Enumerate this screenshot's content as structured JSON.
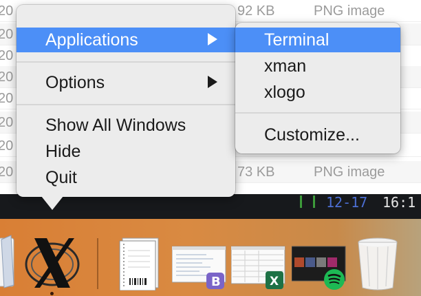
{
  "finder_rows": [
    {
      "date": "20",
      "size": "92 KB",
      "kind": "PNG image"
    },
    {
      "date": "20",
      "size": "",
      "kind": ""
    },
    {
      "date": "20",
      "size": "",
      "kind": ""
    },
    {
      "date": "20",
      "size": "",
      "kind": ""
    },
    {
      "date": "20",
      "size": "",
      "kind": ""
    },
    {
      "date": "20",
      "size": "",
      "kind": ""
    },
    {
      "date": "20",
      "size": "",
      "kind": ""
    },
    {
      "date": "20",
      "size": "73 KB",
      "kind": "PNG image"
    }
  ],
  "terminal": {
    "date": "12-17",
    "time": "16:1"
  },
  "context_menu": {
    "items": [
      {
        "label": "Applications",
        "has_submenu": true,
        "selected": true
      },
      {
        "label": "Options",
        "has_submenu": true,
        "selected": false
      },
      {
        "label": "Show All Windows",
        "has_submenu": false,
        "selected": false
      },
      {
        "label": "Hide",
        "has_submenu": false,
        "selected": false
      },
      {
        "label": "Quit",
        "has_submenu": false,
        "selected": false
      }
    ]
  },
  "submenu": {
    "items": [
      {
        "label": "Terminal",
        "selected": true
      },
      {
        "label": "xman",
        "selected": false
      },
      {
        "label": "xlogo",
        "selected": false
      },
      {
        "label": "Customize...",
        "selected": false
      }
    ]
  },
  "dock": {
    "items": [
      {
        "name": "textedit",
        "icon": "pencil-icon"
      },
      {
        "name": "xquartz",
        "icon": "x11-icon",
        "running": true
      },
      {
        "name": "document",
        "icon": "document-icon"
      },
      {
        "name": "bbedit-window",
        "icon": "bbedit-icon"
      },
      {
        "name": "excel-window",
        "icon": "excel-icon"
      },
      {
        "name": "spotify-window",
        "icon": "spotify-icon"
      },
      {
        "name": "trash",
        "icon": "trash-icon"
      }
    ]
  },
  "colors": {
    "highlight": "#4c8ff7",
    "menu_bg": "#ececec",
    "dock_orange": "#d98a42"
  }
}
